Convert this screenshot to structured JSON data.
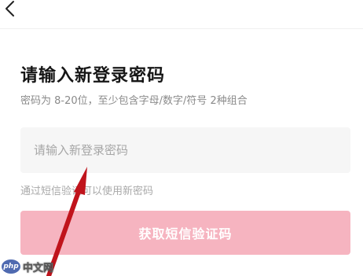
{
  "header": {
    "back_icon": "chevron-left-icon"
  },
  "page": {
    "title": "请输入新登录密码",
    "subtitle": "密码为 8-20位，至少包含字母/数字/符号 2种组合"
  },
  "password_field": {
    "value": "",
    "placeholder": "请输入新登录密码"
  },
  "sms_link": {
    "label": "通过短信验证可以使用新密码"
  },
  "submit_button": {
    "label": "获取短信验证码"
  },
  "annotation": {
    "arrow_icon": "red-arrow-icon"
  },
  "watermark": {
    "logo_text": "php",
    "text": "中文网"
  },
  "colors": {
    "button_bg": "#f6b4c0",
    "field_bg": "#f6f6f6",
    "arrow": "#c0141c",
    "title": "#161616",
    "muted": "#8a8a8a"
  }
}
